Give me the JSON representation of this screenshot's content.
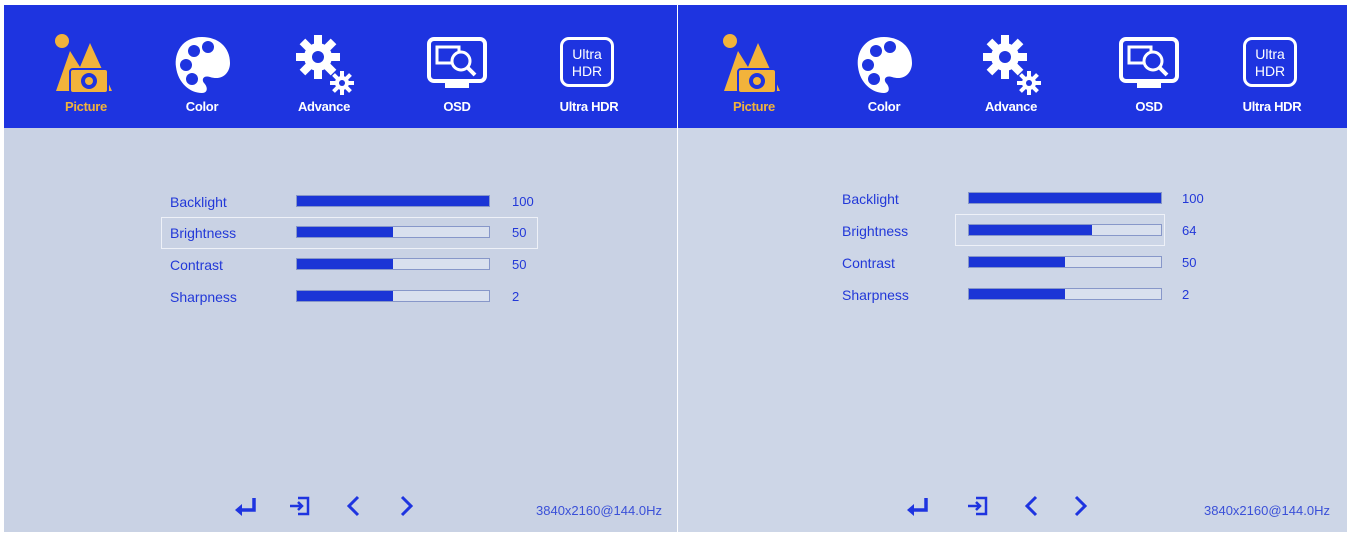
{
  "tabs": [
    "Picture",
    "Color",
    "Advance",
    "OSD",
    "Ultra HDR"
  ],
  "hdr_icon_text": [
    "Ultra",
    "HDR"
  ],
  "resolution": "3840x2160@144.0Hz",
  "colors": {
    "topbar": "#1e34e0",
    "active_tab": "#f2b33b",
    "bar_fill": "#1b35d6",
    "background": "#c9d2e4"
  },
  "screens": [
    {
      "settings": [
        {
          "label": "Backlight",
          "value": "100",
          "level": 100
        },
        {
          "label": "Brightness",
          "value": "50",
          "level": 50
        },
        {
          "label": "Contrast",
          "value": "50",
          "level": 50
        },
        {
          "label": "Sharpness",
          "value": "2",
          "level": 50
        }
      ],
      "selected": "Brightness"
    },
    {
      "settings": [
        {
          "label": "Backlight",
          "value": "100",
          "level": 100
        },
        {
          "label": "Brightness",
          "value": "64",
          "level": 64
        },
        {
          "label": "Contrast",
          "value": "50",
          "level": 50
        },
        {
          "label": "Sharpness",
          "value": "2",
          "level": 50
        }
      ],
      "selected": "Brightness"
    }
  ]
}
